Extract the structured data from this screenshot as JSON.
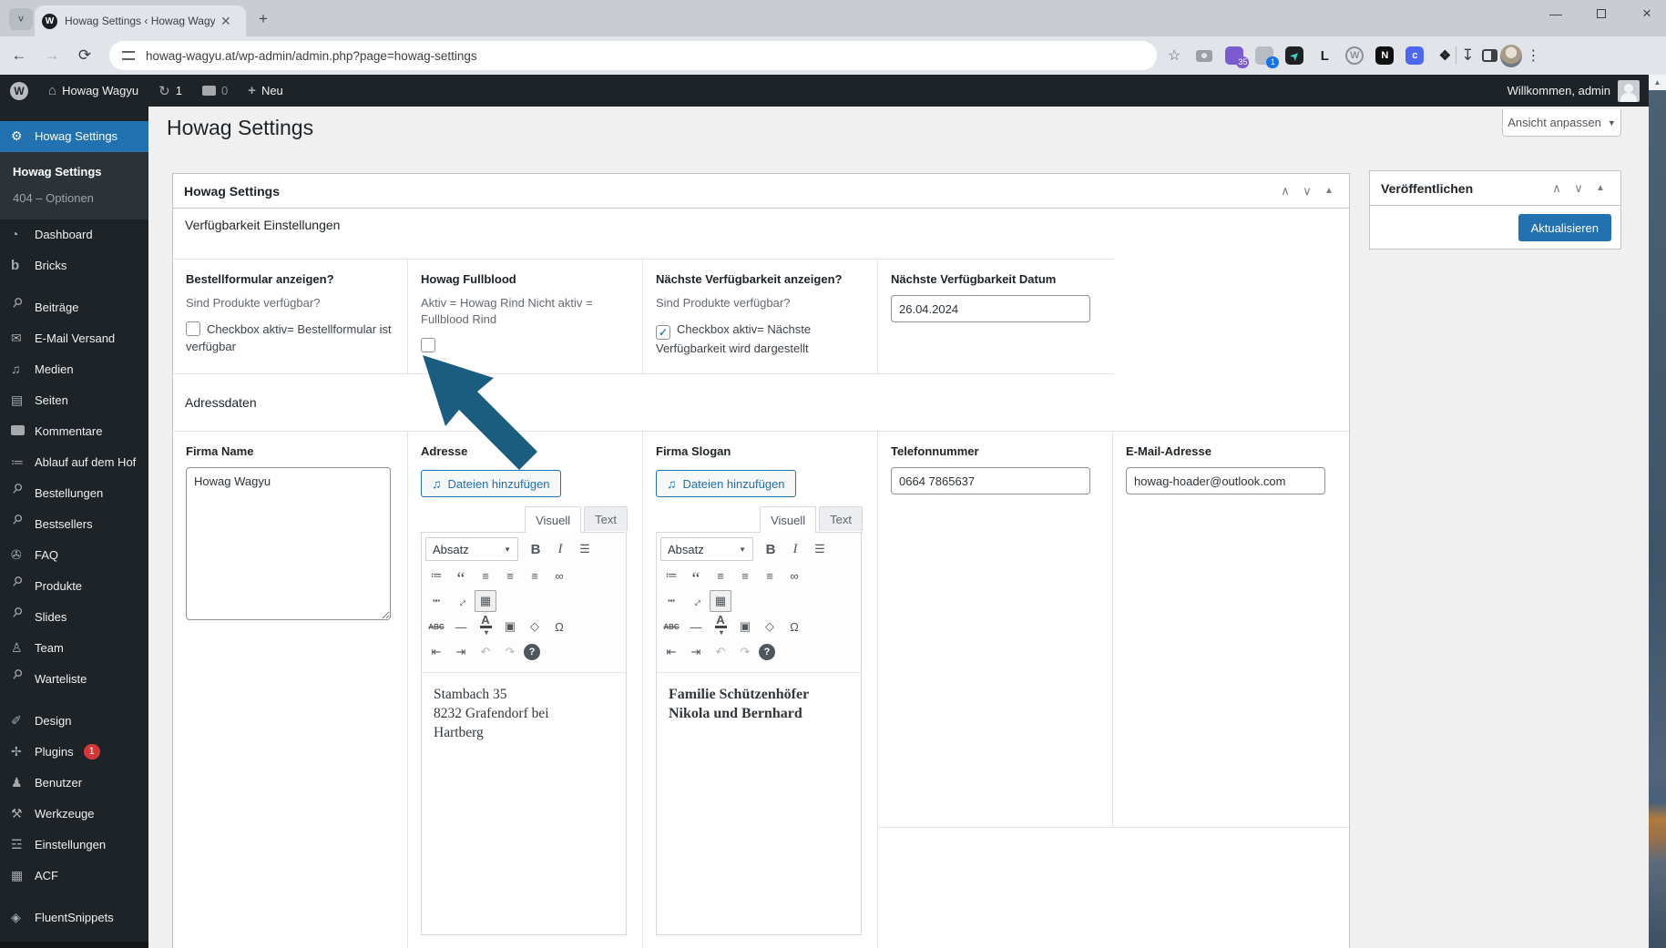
{
  "browser": {
    "tab_title": "Howag Settings ‹ Howag Wagyu",
    "favicon_letter": "W",
    "url": "howag-wagyu.at/wp-admin/admin.php?page=howag-settings",
    "extensions": [
      {
        "name": "screenshot-camera",
        "letter": "",
        "badge": ""
      },
      {
        "name": "password-vault",
        "letter": "",
        "badge": "35",
        "bg": "#7a5cd0",
        "badge_bg": "#7a5cd0"
      },
      {
        "name": "key-manager",
        "letter": "",
        "badge": "1",
        "bg": "#b7bbc2",
        "badge_bg": "#1a73e8"
      },
      {
        "name": "cursor-app",
        "letter": "➤",
        "badge": "",
        "bg": "#202124",
        "fg": "#38d6c4"
      },
      {
        "name": "l-extension",
        "letter": "L",
        "badge": ""
      },
      {
        "name": "wordpress-circle",
        "letter": "W",
        "badge": ""
      },
      {
        "name": "n-extension",
        "letter": "N",
        "badge": "",
        "bg": "#111111",
        "fg": "#ffffff"
      },
      {
        "name": "c-extension",
        "letter": "c",
        "badge": "",
        "bg": "#4d66f3",
        "fg": "#ffffff"
      },
      {
        "name": "extensions-puzzle",
        "letter": "❖",
        "badge": ""
      }
    ]
  },
  "adminbar": {
    "site_name": "Howag Wagyu",
    "update_count": "1",
    "comment_count": "0",
    "new_label": "Neu",
    "welcome": "Willkommen, admin"
  },
  "sidebar": {
    "items": [
      {
        "label": "Howag Settings",
        "icon": "gear",
        "active": true,
        "submenu": [
          {
            "label": "Howag Settings",
            "current": true
          },
          {
            "label": "404 – Optionen"
          }
        ]
      },
      {
        "label": "Dashboard",
        "icon": "dashboard"
      },
      {
        "label": "Bricks",
        "icon": "bricks"
      },
      {
        "label": "Beiträge",
        "icon": "pushpin",
        "gap_before": true
      },
      {
        "label": "E-Mail Versand",
        "icon": "email"
      },
      {
        "label": "Medien",
        "icon": "media"
      },
      {
        "label": "Seiten",
        "icon": "pages"
      },
      {
        "label": "Kommentare",
        "icon": "comment"
      },
      {
        "label": "Ablauf auf dem Hof",
        "icon": "list"
      },
      {
        "label": "Bestellungen",
        "icon": "pushpin"
      },
      {
        "label": "Bestsellers",
        "icon": "pushpin"
      },
      {
        "label": "FAQ",
        "icon": "reel"
      },
      {
        "label": "Produkte",
        "icon": "pushpin"
      },
      {
        "label": "Slides",
        "icon": "pushpin"
      },
      {
        "label": "Team",
        "icon": "person"
      },
      {
        "label": "Warteliste",
        "icon": "pushpin"
      },
      {
        "label": "Design",
        "icon": "brush",
        "gap_before": true
      },
      {
        "label": "Plugins",
        "icon": "plug",
        "badge": "1"
      },
      {
        "label": "Benutzer",
        "icon": "user"
      },
      {
        "label": "Werkzeuge",
        "icon": "tools"
      },
      {
        "label": "Einstellungen",
        "icon": "sliders"
      },
      {
        "label": "ACF",
        "icon": "acf"
      },
      {
        "label": "FluentSnippets",
        "icon": "shield",
        "gap_before": true
      }
    ]
  },
  "page": {
    "title": "Howag Settings",
    "screen_options": "Ansicht anpassen"
  },
  "metabox": {
    "title": "Howag Settings"
  },
  "availability": {
    "heading": "Verfügbarkeit Einstellungen",
    "fields": [
      {
        "label": "Bestellformular anzeigen?",
        "description": "Sind Produkte verfügbar?",
        "checkbox_label": "Checkbox aktiv= Bestellformular ist verfügbar",
        "checked": false
      },
      {
        "label": "Howag Fullblood",
        "description": "Aktiv = Howag Rind Nicht aktiv = Fullblood Rind",
        "checkbox_label": "",
        "checked": false
      },
      {
        "label": "Nächste Verfügbarkeit anzeigen?",
        "description": "Sind Produkte verfügbar?",
        "checkbox_label": "Checkbox aktiv= Nächste Verfügbarkeit wird dargestellt",
        "checked": true
      },
      {
        "label": "Nächste Verfügbarkeit Datum",
        "value": "26.04.2024"
      }
    ]
  },
  "address": {
    "heading": "Adressdaten",
    "firma_name": {
      "label": "Firma Name",
      "value": "Howag Wagyu"
    },
    "adresse": {
      "label": "Adresse",
      "content_lines": [
        "Stambach 35",
        "8232 Grafendorf bei",
        "Hartberg"
      ]
    },
    "slogan": {
      "label": "Firma Slogan",
      "content_lines": [
        "Familie Schützenhöfer",
        "Nikola und Bernhard"
      ]
    },
    "telefon": {
      "label": "Telefonnummer",
      "value": "0664 7865637"
    },
    "email": {
      "label": "E-Mail-Adresse",
      "value": "howag-hoader@outlook.com"
    }
  },
  "editor": {
    "add_media": "Dateien hinzufügen",
    "tabs": [
      "Visuell",
      "Text"
    ],
    "format_select": "Absatz"
  },
  "publish": {
    "title": "Veröffentlichen",
    "update_button": "Aktualisieren"
  },
  "colors": {
    "accent": "#2271b1",
    "admin_dark": "#1d2327",
    "cursor": "#1a5d80",
    "plugin_badge": "#d63638"
  }
}
